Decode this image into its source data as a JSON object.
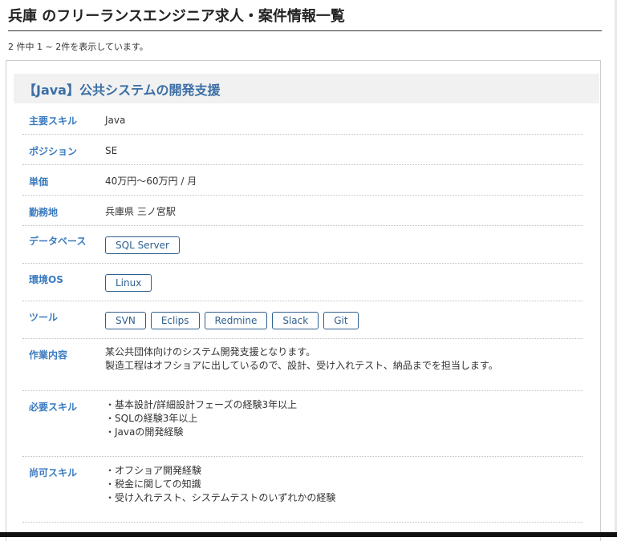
{
  "page": {
    "heading": "兵庫 のフリーランスエンジニア求人・案件情報一覧",
    "result_count": "2 件中 1 ~ 2件を表示しています。"
  },
  "job": {
    "title": "【Java】公共システムの開発支援",
    "main_skill_label": "主要スキル",
    "main_skill_value": "Java",
    "position_label": "ポジション",
    "position_value": "SE",
    "price_label": "単価",
    "price_value": "40万円〜60万円 / 月",
    "location_label": "勤務地",
    "location_value": "兵庫県 三ノ宮駅",
    "database_label": "データベース",
    "database_tags": [
      "SQL Server"
    ],
    "os_label": "環境OS",
    "os_tags": [
      "Linux"
    ],
    "tools_label": "ツール",
    "tools_tags": [
      "SVN",
      "Eclips",
      "Redmine",
      "Slack",
      "Git"
    ],
    "work_label": "作業内容",
    "work_lines": [
      "某公共団体向けのシステム開発支援となります。",
      "製造工程はオフショアに出しているので、設計、受け入れテスト、納品までを担当します。"
    ],
    "required_label": "必要スキル",
    "required_lines": [
      "・基本設計/詳細設計フェーズの経験3年以上",
      "・SQLの経験3年以上",
      "・Javaの開発経験"
    ],
    "preferred_label": "尚可スキル",
    "preferred_lines": [
      "・オフショア開発経験",
      "・税金に関しての知識",
      "・受け入れテスト、システムテストのいずれかの経験"
    ]
  },
  "colors": {
    "title_blue": "#3a6ea5",
    "label_blue": "#3a7bc0",
    "tag_border": "#2f5f8e"
  }
}
